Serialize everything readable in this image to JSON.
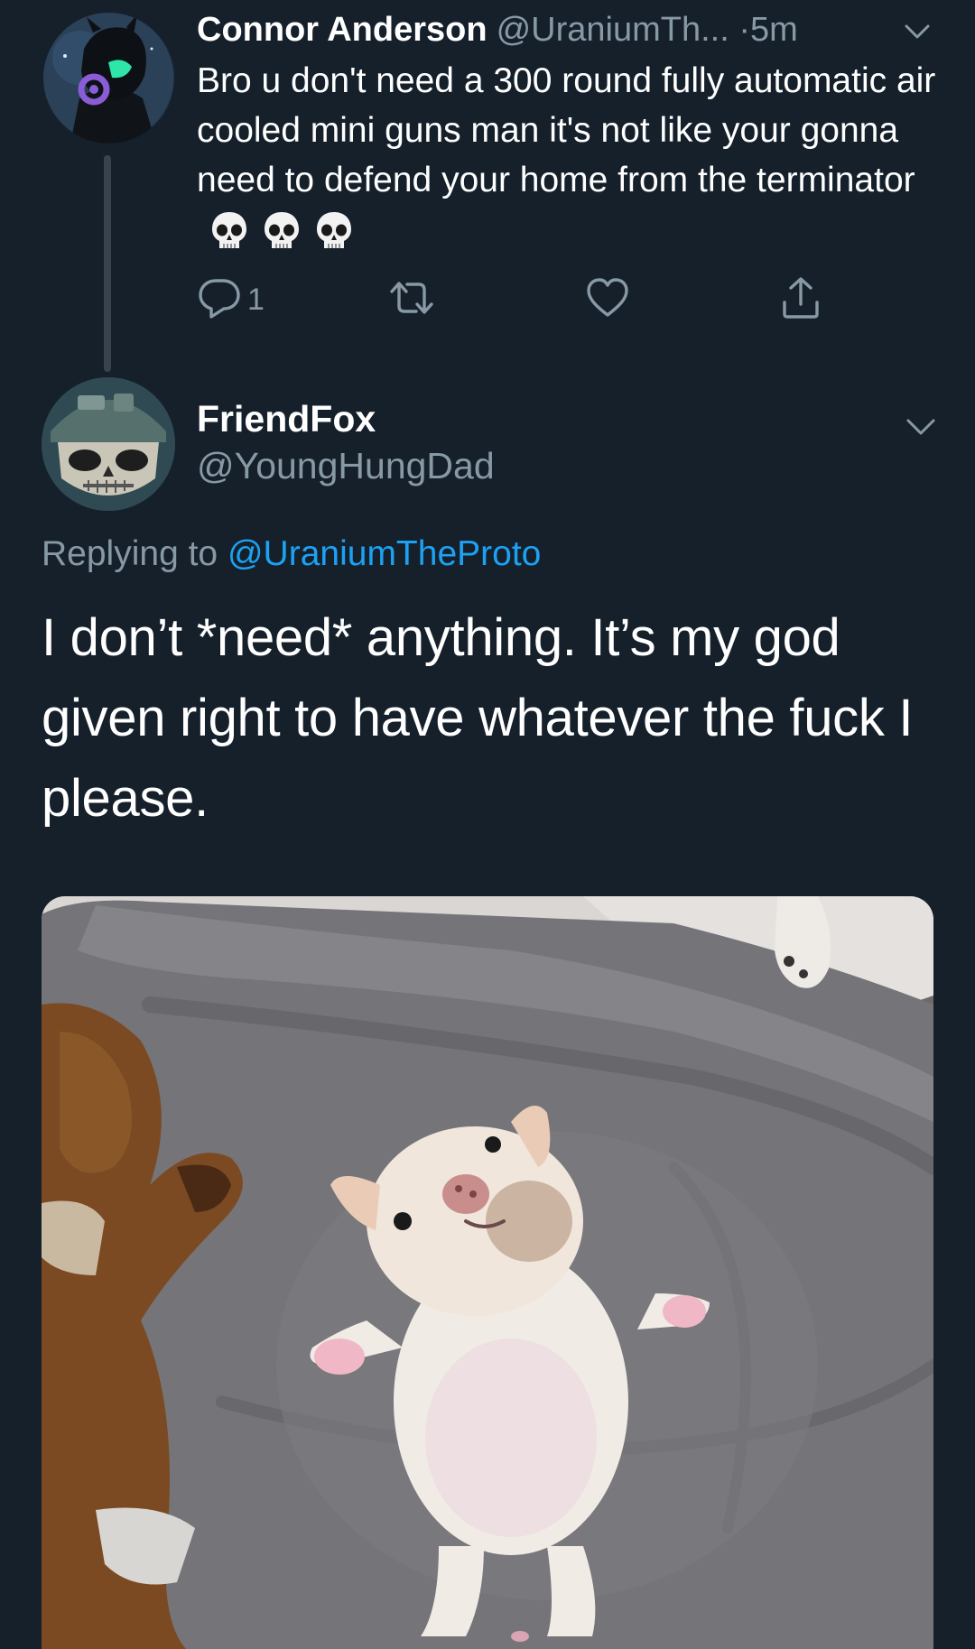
{
  "parent_tweet": {
    "display_name": "Connor Anderson",
    "handle": "@UraniumTh...",
    "separator": "·",
    "time": "5m",
    "text": "Bro u don't need a 300 round fully automatic air cooled mini guns man it's not like your gonna need to defend your home from the terminator",
    "emoji": [
      "💀",
      "💀",
      "💀"
    ],
    "reply_count": "1",
    "icons": {
      "reply": "reply-icon",
      "retweet": "retweet-icon",
      "like": "heart-icon",
      "share": "share-icon",
      "menu": "chevron-down-icon"
    }
  },
  "main_tweet": {
    "display_name": "FriendFox",
    "handle": "@YoungHungDad",
    "replying_prefix": "Replying to",
    "replying_to": "@UraniumTheProto",
    "text": "I don’t *need* anything. It’s my god given right to have whatever the fuck I please.",
    "photo_subject": "puppy lying on its back on a grey cushion next to a brown plush toy"
  },
  "colors": {
    "background": "#15202b",
    "text_primary": "#ffffff",
    "text_secondary": "#8899a6",
    "link": "#1da1f2",
    "thread_line": "#38444d"
  }
}
